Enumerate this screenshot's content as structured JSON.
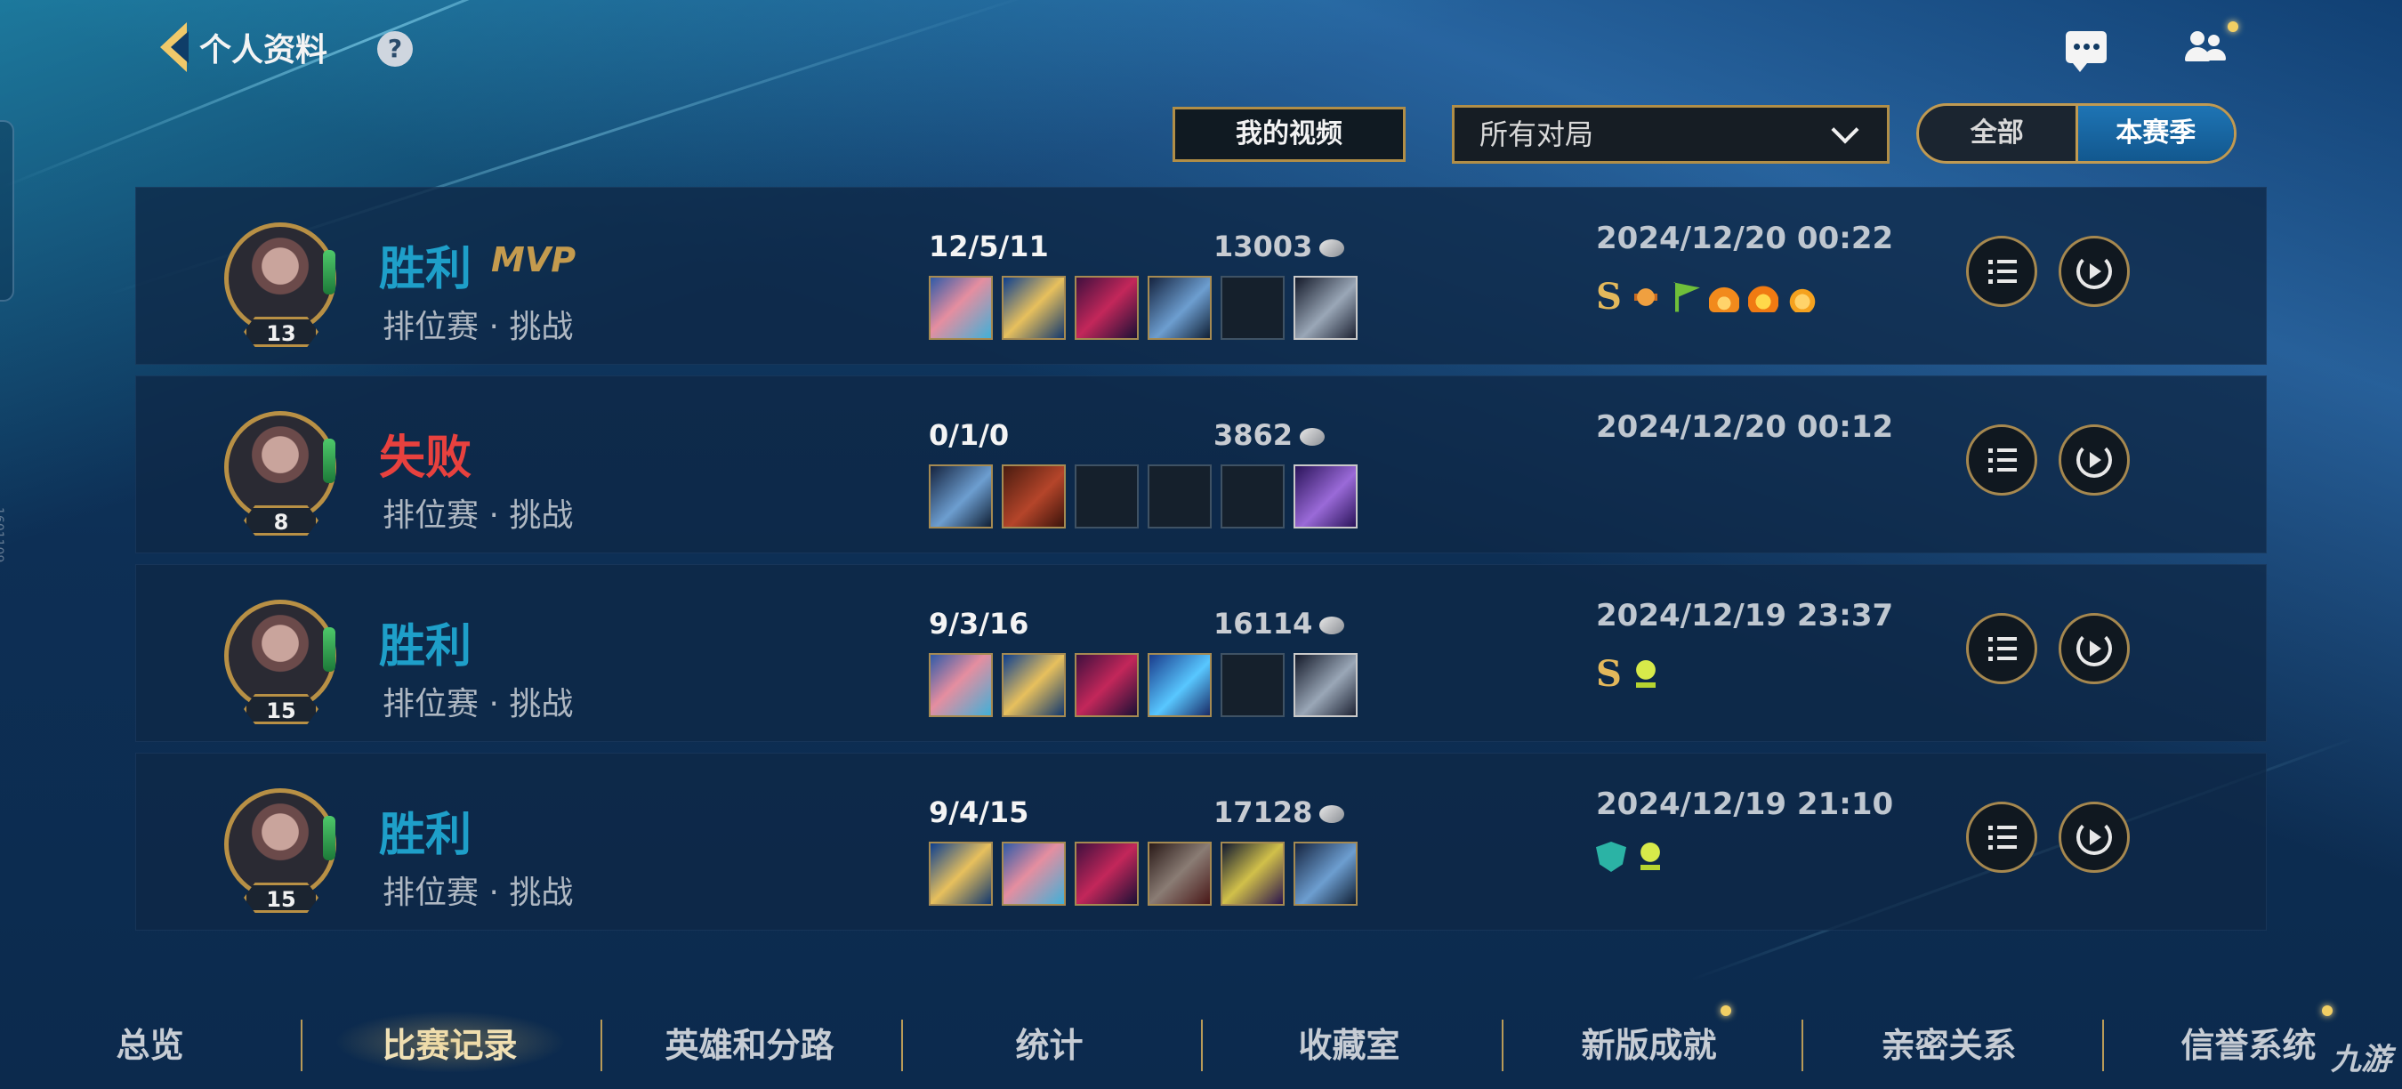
{
  "header": {
    "title": "个人资料",
    "help": "?"
  },
  "controls": {
    "my_video": "我的视频",
    "filter_selected": "所有对局",
    "season_options": [
      "全部",
      "本赛季"
    ],
    "season_selected": "本赛季"
  },
  "matches": [
    {
      "level": "13",
      "result": "胜利",
      "outcome": "win",
      "mvp": "MVP",
      "mode": "排位赛 · 挑战",
      "kda": "12/5/11",
      "gold": "13003",
      "datetime": "2024/12/20 00:22",
      "items": [
        "i-fox",
        "i-gold",
        "i-magenta",
        "i-stone",
        "empty",
        "i-ward"
      ],
      "badges": [
        "S",
        "bug",
        "flag",
        "flame",
        "fire",
        "drop"
      ]
    },
    {
      "level": "8",
      "result": "失败",
      "outcome": "loss",
      "mvp": "",
      "mode": "排位赛 · 挑战",
      "kda": "0/1/0",
      "gold": "3862",
      "datetime": "2024/12/20 00:12",
      "items": [
        "i-stone",
        "i-book",
        "empty",
        "empty",
        "empty",
        "i-boots"
      ],
      "badges": []
    },
    {
      "level": "15",
      "result": "胜利",
      "outcome": "win",
      "mvp": "",
      "mode": "排位赛 · 挑战",
      "kda": "9/3/16",
      "gold": "16114",
      "datetime": "2024/12/19 23:37",
      "items": [
        "i-fox",
        "i-gold",
        "i-magenta",
        "i-blue",
        "empty",
        "i-ward"
      ],
      "badges": [
        "S",
        "trophy"
      ]
    },
    {
      "level": "15",
      "result": "胜利",
      "outcome": "win",
      "mvp": "",
      "mode": "排位赛 · 挑战",
      "kda": "9/4/15",
      "gold": "17128",
      "datetime": "2024/12/19 21:10",
      "items": [
        "i-gold",
        "i-fox",
        "i-magenta",
        "i-dark",
        "i-crown",
        "i-stone"
      ],
      "badges": [
        "shield",
        "trophy"
      ]
    }
  ],
  "bottom_nav": [
    "总览",
    "比赛记录",
    "英雄和分路",
    "统计",
    "收藏室",
    "新版成就",
    "亲密关系",
    "信誉系统"
  ],
  "bottom_nav_active": "比赛记录",
  "watermark": "九游",
  "colors": {
    "win": "#1e9fc9",
    "loss": "#e8413e",
    "accent_gold": "#b18e47",
    "toggle_active": "#1e74b4"
  }
}
